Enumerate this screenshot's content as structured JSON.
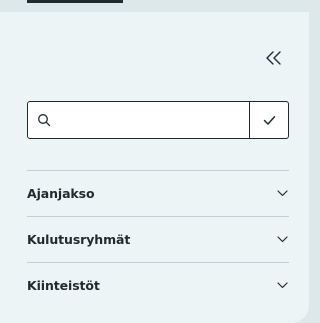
{
  "sidebar": {
    "collapse_icon": "double-chevron-left-icon",
    "search": {
      "value": "",
      "placeholder": "",
      "search_icon": "search-icon",
      "submit_icon": "check-icon"
    },
    "filters": [
      {
        "label": "Ajanjakso",
        "icon": "chevron-down-icon"
      },
      {
        "label": "Kulutusryhmät",
        "icon": "chevron-down-icon"
      },
      {
        "label": "Kiinteistöt",
        "icon": "chevron-down-icon"
      }
    ]
  },
  "colors": {
    "background": "#dce8ea",
    "panel": "#edf4f5",
    "text": "#1f2b2e",
    "divider": "#c3cfd2",
    "input_background": "#ffffff"
  }
}
